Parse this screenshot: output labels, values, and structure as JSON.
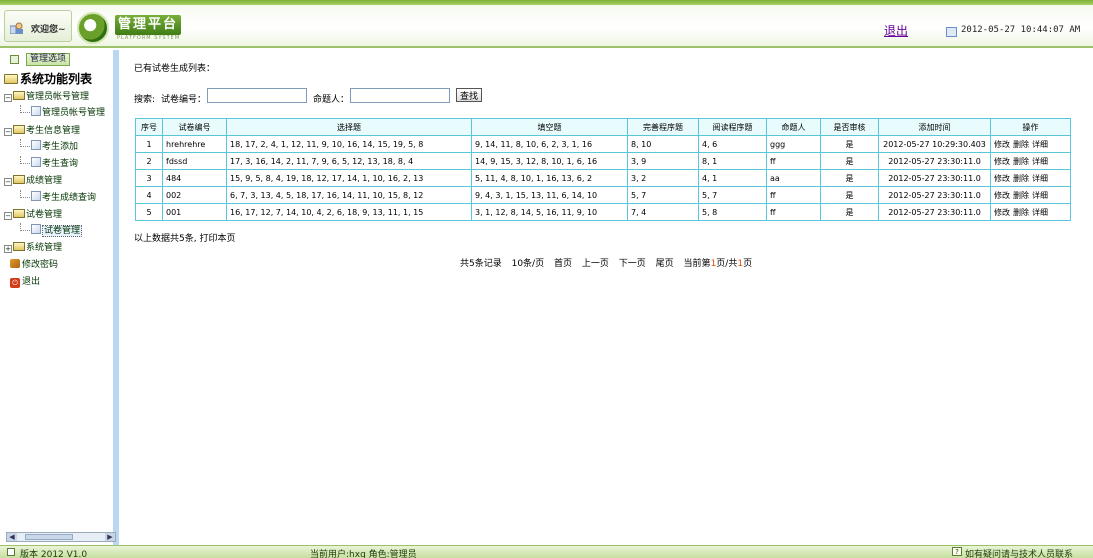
{
  "header": {
    "welcome": "欢迎您~",
    "logo_title": "管理平台",
    "logo_sub": "PLATFORM SYSTEM",
    "logout": "退出",
    "datetime": "2012-05-27 10:44:07 AM"
  },
  "sidebar": {
    "header_button": "管理选项",
    "root": "系统功能列表",
    "items": [
      {
        "label": "管理员帐号管理"
      },
      {
        "label": "管理员帐号管理"
      },
      {
        "label": "考生信息管理"
      },
      {
        "label": "考生添加"
      },
      {
        "label": "考生查询"
      },
      {
        "label": "成绩管理"
      },
      {
        "label": "考生成绩查询"
      },
      {
        "label": "试卷管理"
      },
      {
        "label": "试卷管理"
      },
      {
        "label": "系统管理"
      },
      {
        "label": "修改密码"
      },
      {
        "label": "退出"
      }
    ]
  },
  "main": {
    "title": "已有试卷生成列表：",
    "search": {
      "label": "搜索:",
      "paper_no_label": "试卷编号：",
      "paper_no_value": "",
      "author_label": "命题人：",
      "author_value": "",
      "button": "查找"
    },
    "table": {
      "headers": [
        "序号",
        "试卷编号",
        "选择题",
        "填空题",
        "完善程序题",
        "阅读程序题",
        "命题人",
        "是否审核",
        "添加时间",
        "操作"
      ],
      "rows": [
        [
          "1",
          "hrehrehre",
          "18, 17, 2, 4, 1, 12, 11, 9, 10, 16, 14, 15, 19, 5, 8",
          "9, 14, 11, 8, 10, 6, 2, 3, 1, 16",
          "8, 10",
          "4, 6",
          "ggg",
          "是",
          "2012-05-27 10:29:30.403"
        ],
        [
          "2",
          "fdssd",
          "17, 3, 16, 14, 2, 11, 7, 9, 6, 5, 12, 13, 18, 8, 4",
          "14, 9, 15, 3, 12, 8, 10, 1, 6, 16",
          "3, 9",
          "8, 1",
          "ff",
          "是",
          "2012-05-27 23:30:11.0"
        ],
        [
          "3",
          "484",
          "15, 9, 5, 8, 4, 19, 18, 12, 17, 14, 1, 10, 16, 2, 13",
          "5, 11, 4, 8, 10, 1, 16, 13, 6, 2",
          "3, 2",
          "4, 1",
          "aa",
          "是",
          "2012-05-27 23:30:11.0"
        ],
        [
          "4",
          "002",
          "6, 7, 3, 13, 4, 5, 18, 17, 16, 14, 11, 10, 15, 8, 12",
          "9, 4, 3, 1, 15, 13, 11, 6, 14, 10",
          "5, 7",
          "5, 7",
          "ff",
          "是",
          "2012-05-27 23:30:11.0"
        ],
        [
          "5",
          "001",
          "16, 17, 12, 7, 14, 10, 4, 2, 6, 18, 9, 13, 11, 1, 15",
          "3, 1, 12, 8, 14, 5, 16, 11, 9, 10",
          "7, 4",
          "5, 8",
          "ff",
          "是",
          "2012-05-27 23:30:11.0"
        ]
      ],
      "ops": [
        "修改",
        "删除",
        "详细"
      ]
    },
    "summary": "以上数据共5条, 打印本页",
    "pager": {
      "total": "共5条记录",
      "per_page": "10条/页",
      "first": "首页",
      "prev": "上一页",
      "next": "下一页",
      "last": "尾页",
      "current_prefix": "当前第",
      "current_page": "1",
      "current_mid": "页/共",
      "total_pages": "1",
      "current_suffix": "页"
    }
  },
  "footer": {
    "version": "版本 2012 V1.0",
    "user": "当前用户:hxg  角色:管理员",
    "help": "如有疑问请与技术人员联系"
  }
}
